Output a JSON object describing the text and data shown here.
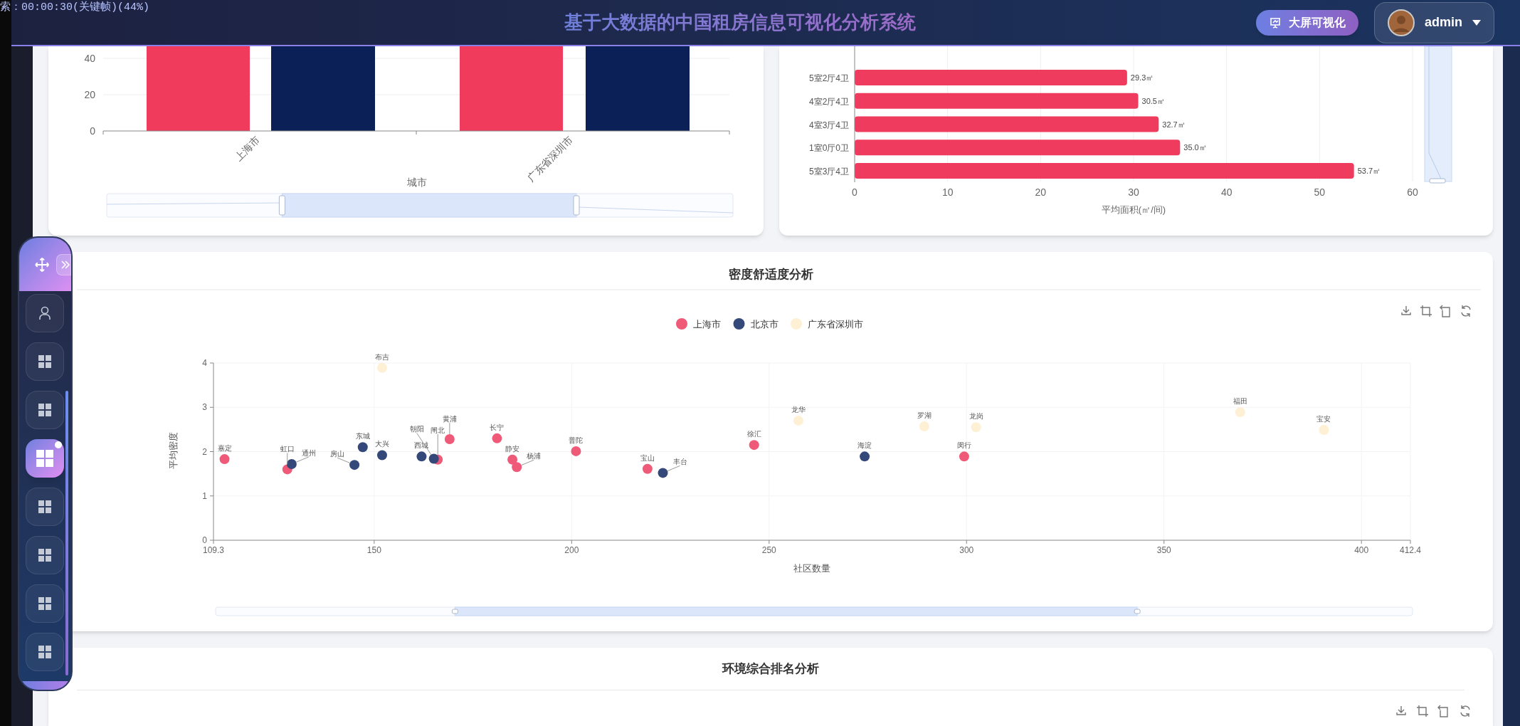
{
  "overlay_text": "索：00:00:30(关键帧)(44%)",
  "header": {
    "title": "基于大数据的中国租房信息可视化分析系统",
    "screen_button": "大屏可视化",
    "user": "admin"
  },
  "side_dock": {
    "items": [
      {
        "kind": "user",
        "selected": false
      },
      {
        "kind": "grid",
        "selected": false
      },
      {
        "kind": "grid",
        "selected": false
      },
      {
        "kind": "grid",
        "selected": true
      },
      {
        "kind": "grid",
        "selected": false
      },
      {
        "kind": "grid",
        "selected": false
      },
      {
        "kind": "grid",
        "selected": false
      },
      {
        "kind": "grid",
        "selected": false
      }
    ]
  },
  "city_chart": {
    "y_ticks": [
      "40",
      "20",
      "0"
    ],
    "categories": [
      "上海市",
      "广东省深圳市"
    ],
    "axis_title": "城市",
    "slider": {
      "handles": [
        {
          "level": 0.28
        },
        {
          "level": 0.75
        }
      ]
    }
  },
  "area_chart": {
    "chart_data": {
      "type": "bar",
      "orientation": "horizontal",
      "grid": true,
      "xlabel": "平均面积(㎡/间)",
      "categories": [
        "5室2厅4卫",
        "4室2厅4卫",
        "4室3厅4卫",
        "1室0厅0卫",
        "5室3厅4卫"
      ],
      "series": [
        {
          "color": "#ef3b5d",
          "values": [
            29.3,
            30.5,
            32.7,
            35.0,
            53.7
          ]
        }
      ],
      "xlim": [
        0,
        60
      ],
      "xticks": [
        0,
        10,
        20,
        30,
        40,
        50,
        60
      ],
      "value_labels": [
        "29.3㎡",
        "30.5㎡",
        "32.7㎡",
        "35.0㎡",
        "53.7㎡"
      ]
    },
    "slider": {
      "handles": [
        {
          "level": 0.0
        }
      ]
    }
  },
  "density_card": {
    "title": "密度舒适度分析",
    "chart_data": {
      "type": "scatter",
      "grid": true,
      "xlabel": "社区数量",
      "ylabel": "平均密度",
      "xlim": [
        109.3,
        412.4
      ],
      "ylim": [
        0,
        4
      ],
      "xticks": [
        109.3,
        150,
        200,
        250,
        300,
        350,
        400,
        412.4
      ],
      "yticks": [
        0,
        1,
        2,
        3,
        4
      ],
      "series": [
        {
          "name": "上海市",
          "color": "#ee5a78",
          "x": [
            112.1,
            128.0,
            166.1,
            169.1,
            181.1,
            185.0,
            186.1,
            201.1,
            219.2,
            246.2,
            299.4
          ],
          "values": [
            1.83,
            1.6,
            1.82,
            2.28,
            2.3,
            1.82,
            1.65,
            2.01,
            1.61,
            2.15,
            1.89
          ]
        },
        {
          "name": "北京市",
          "color": "#34497a",
          "x": [
            129.1,
            145.0,
            147.1,
            152.0,
            162.0,
            165.1,
            223.1,
            274.2
          ],
          "values": [
            1.72,
            1.7,
            2.1,
            1.92,
            1.89,
            1.84,
            1.52,
            1.89
          ]
        },
        {
          "name": "广东省深圳市",
          "color": "#fdf0d5",
          "x": [
            152.0,
            257.4,
            289.3,
            302.4,
            369.3,
            390.5
          ],
          "values": [
            3.89,
            2.7,
            2.57,
            2.55,
            2.89,
            2.49
          ]
        }
      ],
      "legend": true,
      "annotations": [
        {
          "x": 112.1,
          "y": 1.83,
          "text": "嘉定"
        },
        {
          "x": 128.0,
          "y": 1.6,
          "text": "虹口"
        },
        {
          "x": 166.1,
          "y": 1.82,
          "text": "闸北"
        },
        {
          "x": 169.1,
          "y": 2.28,
          "text": "黄浦"
        },
        {
          "x": 181.1,
          "y": 2.3,
          "text": "长宁"
        },
        {
          "x": 185.0,
          "y": 1.82,
          "text": "静安"
        },
        {
          "x": 186.1,
          "y": 1.65,
          "text": "杨浦"
        },
        {
          "x": 201.1,
          "y": 2.01,
          "text": "普陀"
        },
        {
          "x": 219.2,
          "y": 1.61,
          "text": "宝山"
        },
        {
          "x": 246.2,
          "y": 2.15,
          "text": "徐汇"
        },
        {
          "x": 299.4,
          "y": 1.89,
          "text": "闵行"
        },
        {
          "x": 129.1,
          "y": 1.72,
          "text": "通州"
        },
        {
          "x": 145.0,
          "y": 1.7,
          "text": "房山"
        },
        {
          "x": 147.1,
          "y": 2.1,
          "text": "东城"
        },
        {
          "x": 152.0,
          "y": 1.92,
          "text": "大兴"
        },
        {
          "x": 162.0,
          "y": 1.89,
          "text": "西城"
        },
        {
          "x": 165.1,
          "y": 1.84,
          "text": "朝阳"
        },
        {
          "x": 223.1,
          "y": 1.52,
          "text": "丰台"
        },
        {
          "x": 274.2,
          "y": 1.89,
          "text": "海淀"
        },
        {
          "x": 152.0,
          "y": 3.89,
          "text": "布吉"
        },
        {
          "x": 257.4,
          "y": 2.7,
          "text": "龙华"
        },
        {
          "x": 289.3,
          "y": 2.57,
          "text": "罗湖"
        },
        {
          "x": 302.4,
          "y": 2.55,
          "text": "龙岗"
        },
        {
          "x": 369.3,
          "y": 2.89,
          "text": "福田"
        },
        {
          "x": 390.5,
          "y": 2.49,
          "text": "宝安"
        }
      ]
    },
    "slider": {
      "handles": [
        {
          "level": 0.2
        },
        {
          "level": 0.77
        }
      ]
    }
  },
  "ranking_card": {
    "title": "环境综合排名分析"
  }
}
